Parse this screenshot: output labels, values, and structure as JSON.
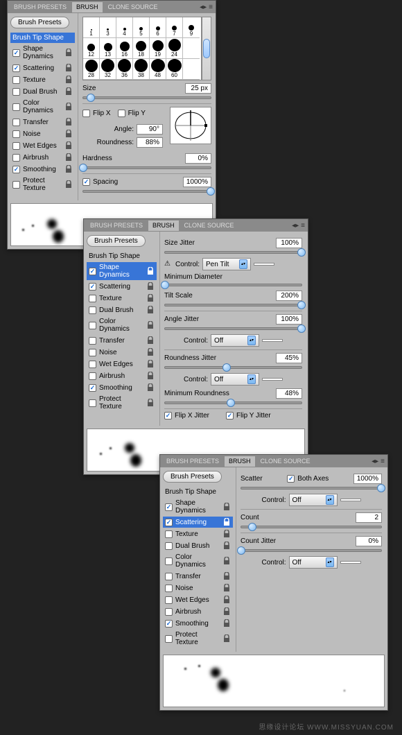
{
  "tabs": {
    "presets": "BRUSH PRESETS",
    "brush": "BRUSH",
    "clone": "CLONE SOURCE"
  },
  "brushPresetsBtn": "Brush Presets",
  "options": {
    "tipShape": "Brush Tip Shape",
    "shapeDynamics": "Shape Dynamics",
    "scattering": "Scattering",
    "texture": "Texture",
    "dualBrush": "Dual Brush",
    "colorDynamics": "Color Dynamics",
    "transfer": "Transfer",
    "noise": "Noise",
    "wetEdges": "Wet Edges",
    "airbrush": "Airbrush",
    "smoothing": "Smoothing",
    "protectTexture": "Protect Texture"
  },
  "panel1": {
    "grid_row1": [
      "1",
      "3",
      "4",
      "5",
      "6",
      "7",
      "9"
    ],
    "grid_row2": [
      "12",
      "13",
      "16",
      "18",
      "19",
      "24"
    ],
    "grid_row3": [
      "28",
      "32",
      "36",
      "38",
      "48",
      "60"
    ],
    "sizeLabel": "Size",
    "sizeVal": "25 px",
    "flipX": "Flip X",
    "flipY": "Flip Y",
    "angleLabel": "Angle:",
    "angleVal": "90°",
    "roundnessLabel": "Roundness:",
    "roundnessVal": "88%",
    "hardnessLabel": "Hardness",
    "hardnessVal": "0%",
    "spacingLabel": "Spacing",
    "spacingVal": "1000%"
  },
  "panel2": {
    "sizeJitterLabel": "Size Jitter",
    "sizeJitterVal": "100%",
    "controlLabel": "Control:",
    "sizeControl": "Pen Tilt",
    "minDiameterLabel": "Minimum Diameter",
    "tiltScaleLabel": "Tilt Scale",
    "tiltScaleVal": "200%",
    "angleJitterLabel": "Angle Jitter",
    "angleJitterVal": "100%",
    "angleControl": "Off",
    "roundJitterLabel": "Roundness Jitter",
    "roundJitterVal": "45%",
    "roundControl": "Off",
    "minRoundLabel": "Minimum Roundness",
    "minRoundVal": "48%",
    "flipXJitter": "Flip X Jitter",
    "flipYJitter": "Flip Y Jitter"
  },
  "panel3": {
    "scatterLabel": "Scatter",
    "bothAxes": "Both Axes",
    "scatterVal": "1000%",
    "control1": "Off",
    "countLabel": "Count",
    "countVal": "2",
    "countJitterLabel": "Count Jitter",
    "countJitterVal": "0%",
    "control2": "Off"
  },
  "watermark": "思缘设计论坛  WWW.MISSYUAN.COM"
}
